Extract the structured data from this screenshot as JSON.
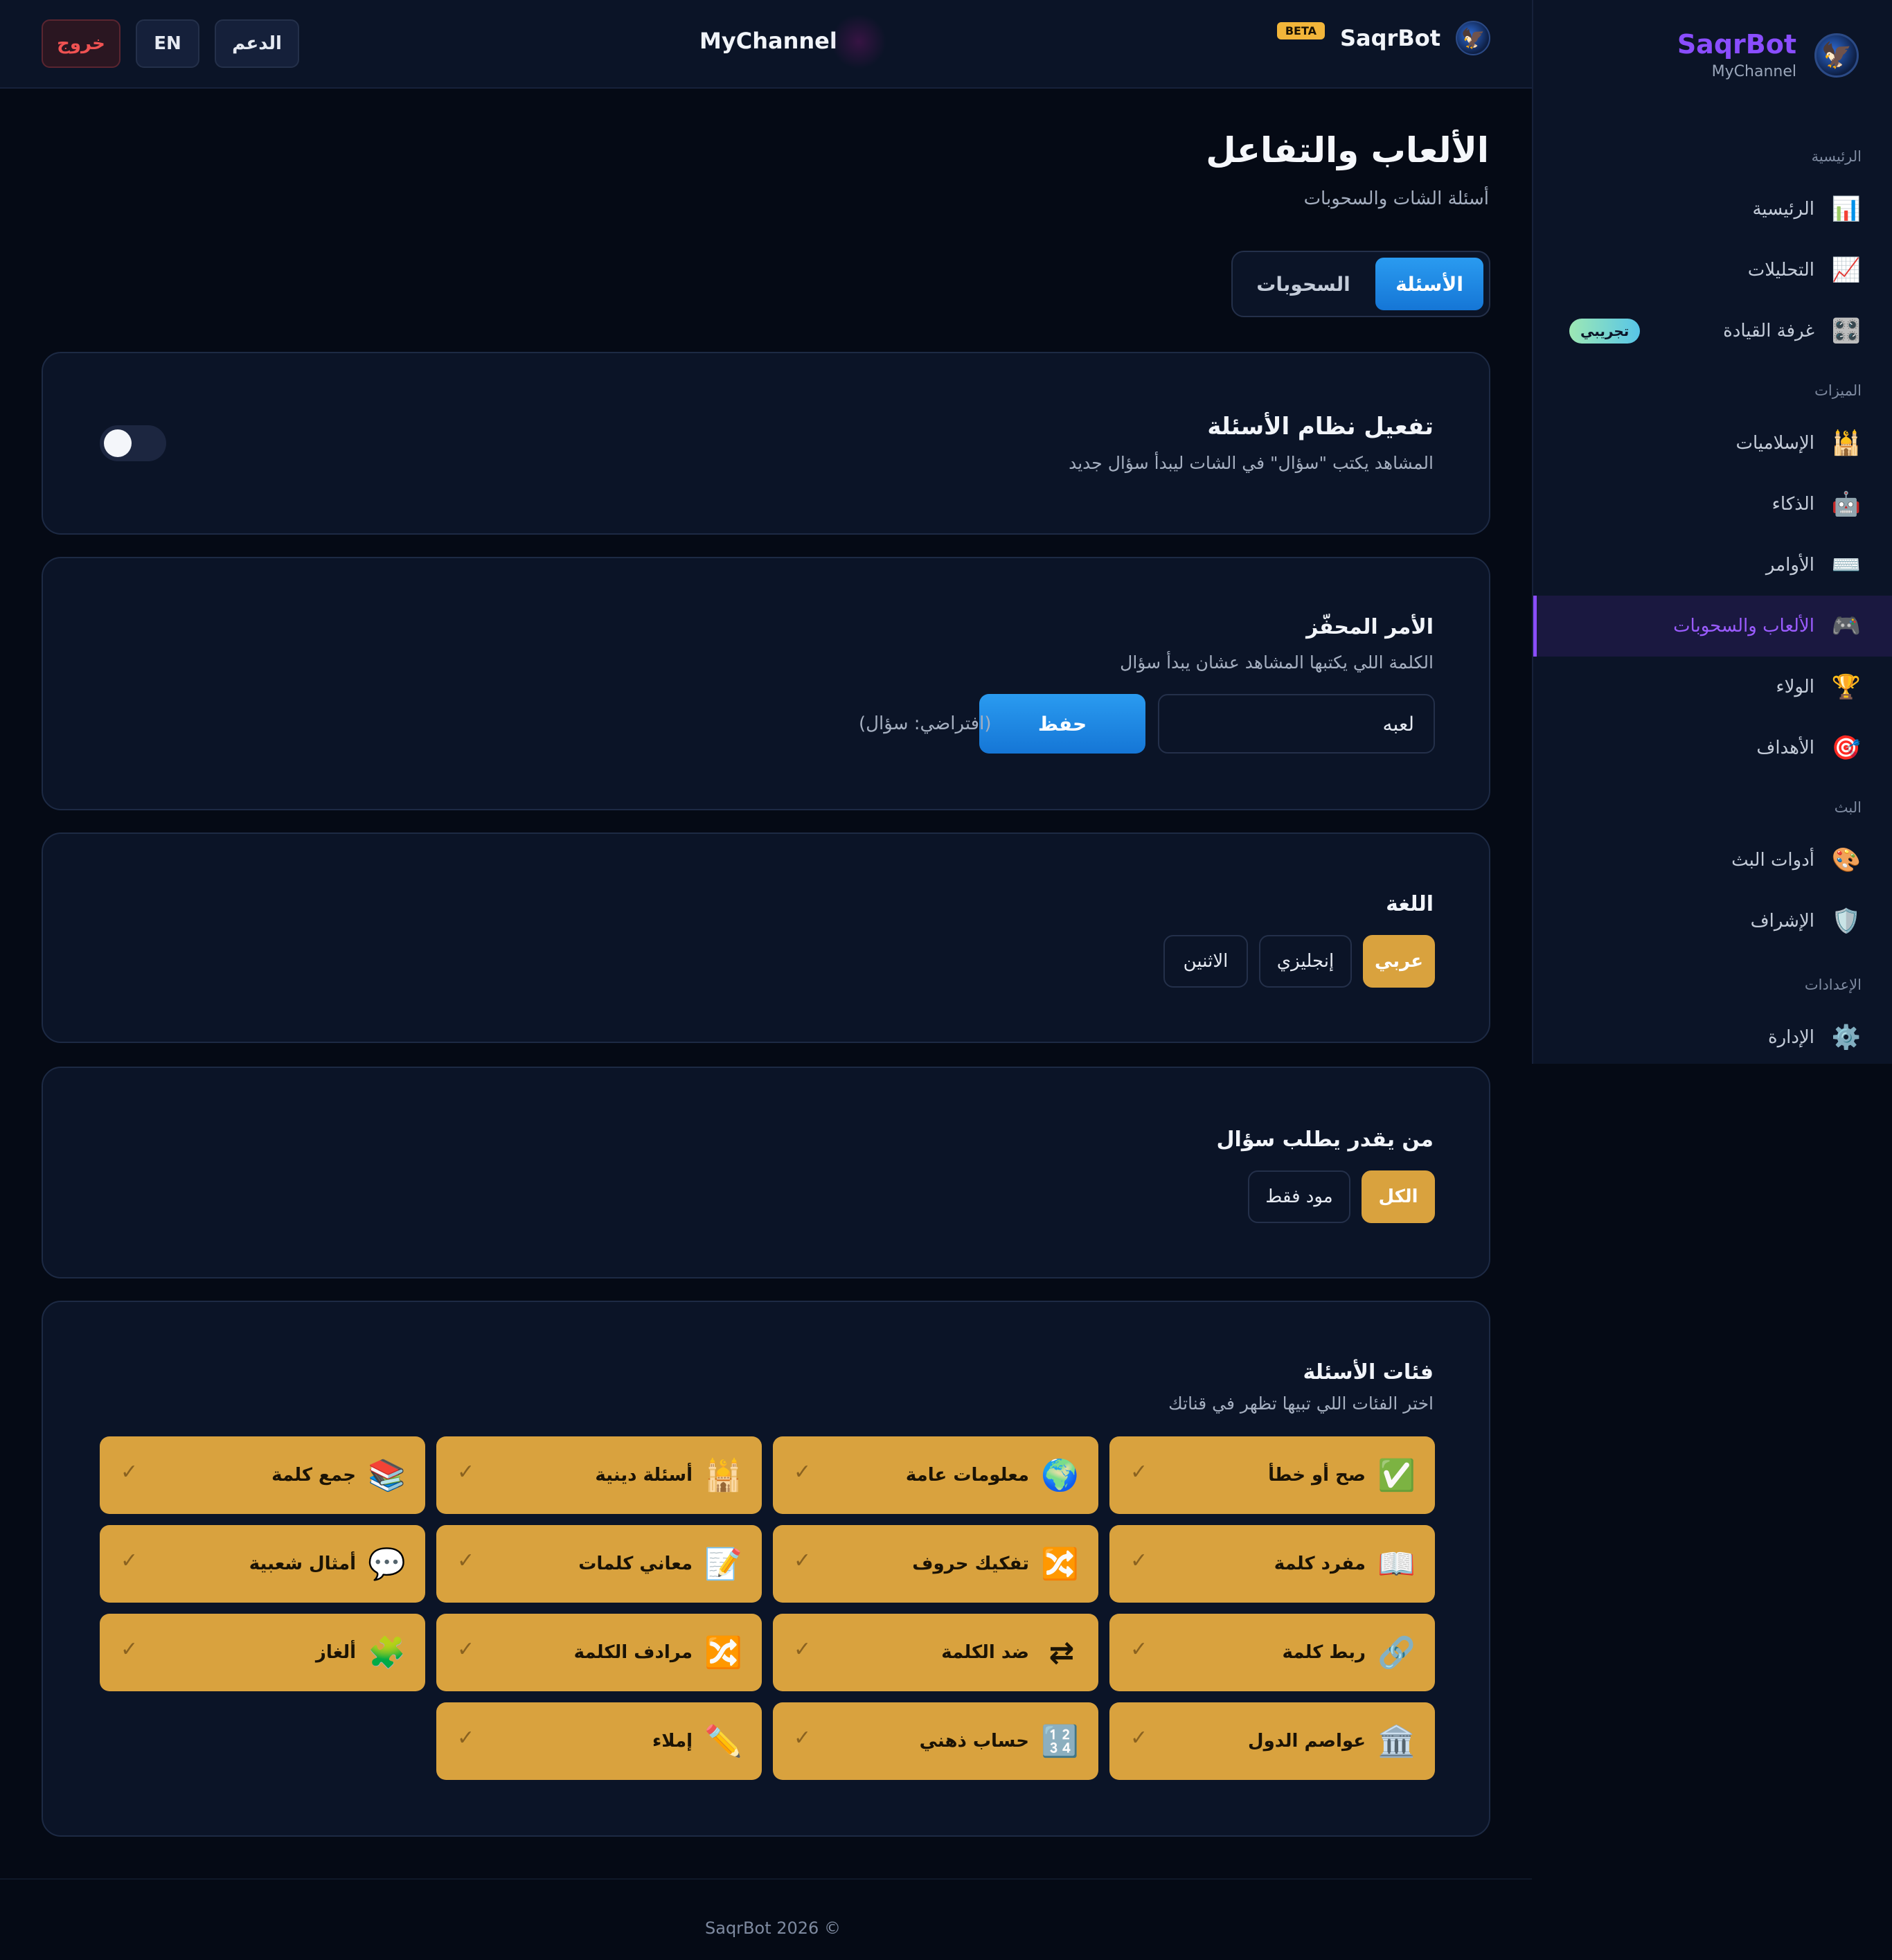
{
  "topbar": {
    "logout_label": "خروج",
    "lang_label": "EN",
    "support_label": "الدعم",
    "channel": "MyChannel",
    "brand_name": "SaqrBot",
    "beta": "BETA",
    "logo_icon": "eagle-icon"
  },
  "sidebar": {
    "brand_name": "SaqrBot",
    "brand_sub": "MyChannel",
    "brand_color": "#8a4dff",
    "sections": {
      "main": "الرئيسية",
      "features": "الميزات",
      "stream": "البث",
      "settings": "الإعدادات"
    },
    "items": {
      "home": {
        "label": "الرئيسية",
        "icon": "📊"
      },
      "analytics": {
        "label": "التحليلات",
        "icon": "📈"
      },
      "cockpit": {
        "label": "غرفة القيادة",
        "icon": "🎛️",
        "badge": "تجريبي"
      },
      "islamic": {
        "label": "الإسلاميات",
        "icon": "🕌"
      },
      "ai": {
        "label": "الذكاء",
        "icon": "🤖"
      },
      "commands": {
        "label": "الأوامر",
        "icon": "⌨️"
      },
      "games": {
        "label": "الألعاب والسحوبات",
        "icon": "🎮",
        "active": true
      },
      "loyalty": {
        "label": "الولاء",
        "icon": "🏆"
      },
      "goals": {
        "label": "الأهداف",
        "icon": "🎯"
      },
      "tools": {
        "label": "أدوات البث",
        "icon": "🎨"
      },
      "moderation": {
        "label": "الإشراف",
        "icon": "🛡️"
      },
      "admin": {
        "label": "الإدارة",
        "icon": "⚙️"
      }
    }
  },
  "page": {
    "title": "الألعاب والتفاعل",
    "subtitle": "أسئلة الشات والسحوبات",
    "tabs": {
      "questions": "الأسئلة",
      "draws": "السحوبات"
    }
  },
  "toggle_card": {
    "title": "تفعيل نظام الأسئلة",
    "desc": "المشاهد يكتب \"سؤال\" في الشات ليبدأ سؤال جديد",
    "enabled": false
  },
  "trigger_card": {
    "title": "الأمر المحفّز",
    "desc": "الكلمة اللي يكتبها المشاهد عشان يبدأ سؤال",
    "value": "لعبه",
    "save_label": "حفظ",
    "hint": "(افتراضي: سؤال)"
  },
  "language_card": {
    "title": "اللغة",
    "options": {
      "ar": "عربي",
      "en": "إنجليزي",
      "both": "الاثنين"
    },
    "selected": "عربي"
  },
  "permission_card": {
    "title": "من يقدر يطلب سؤال",
    "options": {
      "all": "الكل",
      "mods": "مود فقط"
    },
    "selected": "الكل"
  },
  "categories_card": {
    "title": "فئات الأسئلة",
    "desc": "اختر الفئات اللي تبيها تظهر في قناتك",
    "check": "✓",
    "accent": "#d9a23e",
    "items": [
      {
        "icon": "✅",
        "label": "صح أو خطأ"
      },
      {
        "icon": "🌍",
        "label": "معلومات عامة"
      },
      {
        "icon": "🕌",
        "label": "أسئلة دينية"
      },
      {
        "icon": "📚",
        "label": "جمع كلمة"
      },
      {
        "icon": "📖",
        "label": "مفرد كلمة"
      },
      {
        "icon": "🔀",
        "label": "تفكيك حروف"
      },
      {
        "icon": "📝",
        "label": "معاني كلمات"
      },
      {
        "icon": "💬",
        "label": "أمثال شعبية"
      },
      {
        "icon": "🔗",
        "label": "ربط كلمة"
      },
      {
        "icon": "⇄",
        "label": "ضد الكلمة"
      },
      {
        "icon": "🔀",
        "label": "مرادف الكلمة"
      },
      {
        "icon": "🧩",
        "label": "ألغاز"
      },
      {
        "icon": "🏛️",
        "label": "عواصم الدول"
      },
      {
        "icon": "🔢",
        "label": "حساب ذهني"
      },
      {
        "icon": "✏️",
        "label": "إملاء"
      }
    ]
  },
  "footer": {
    "text": "SaqrBot 2026 ©"
  }
}
